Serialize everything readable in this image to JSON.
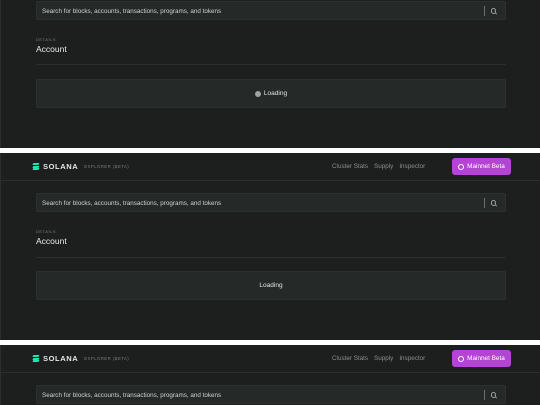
{
  "header": {
    "brand_name": "SOLANA",
    "brand_subtitle": "EXPLORER (BETA)",
    "nav": [
      "Cluster Stats",
      "Supply",
      "Inspector"
    ],
    "cluster_button": "Mainnet Beta"
  },
  "search": {
    "placeholder": "Search for blocks, accounts, transactions, programs, and tokens"
  },
  "page": {
    "caption": "DETAILS",
    "title": "Account"
  },
  "status": {
    "loading_label": "Loading"
  },
  "colors": {
    "background": "#1c1f1e",
    "surface": "#252928",
    "brand_accent": "#1ce5b0",
    "cluster_button": "#b544d6"
  }
}
